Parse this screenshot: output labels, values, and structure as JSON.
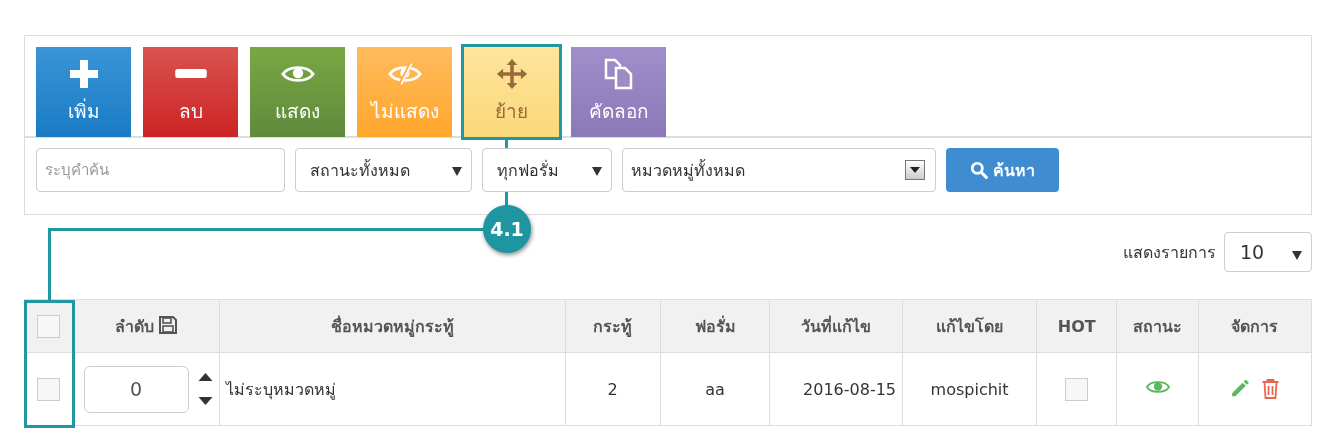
{
  "toolbar": [
    {
      "kind": "add",
      "label": "เพิ่ม",
      "highlighted": false
    },
    {
      "kind": "delete",
      "label": "ลบ",
      "highlighted": false
    },
    {
      "kind": "show",
      "label": "แสดง",
      "highlighted": false
    },
    {
      "kind": "hide",
      "label": "ไม่แสดง",
      "highlighted": false
    },
    {
      "kind": "move",
      "label": "ย้าย",
      "highlighted": true
    },
    {
      "kind": "copy",
      "label": "คัดลอก",
      "highlighted": false
    }
  ],
  "filters": {
    "search": {
      "placeholder": "ระบุคำค้น"
    },
    "status": "สถานะทั้งหมด",
    "forum": "ทุกฟอรั่ม",
    "category": "หมวดหมู่ทั้งหมด",
    "search_button": "ค้นหา"
  },
  "callout": {
    "label": "4.1"
  },
  "page_size": {
    "label": "แสดงรายการ",
    "value": "10"
  },
  "table": {
    "select_all": {
      "checked": false
    },
    "columns": [
      "ลำดับ",
      "ชื่อหมวดหมู่กระทู้",
      "กระทู้",
      "ฟอรั่ม",
      "วันที่แก้ไข",
      "แก้ไขโดย",
      "HOT",
      "สถานะ",
      "จัดการ"
    ],
    "rows": [
      {
        "checked": false,
        "order": "0",
        "name": "ไม่ระบุหมวดหมู่",
        "threads": "2",
        "forum": "aa",
        "date": "2016-08-15",
        "edited_by": "mospichit",
        "hot": false,
        "visible": true
      }
    ]
  }
}
